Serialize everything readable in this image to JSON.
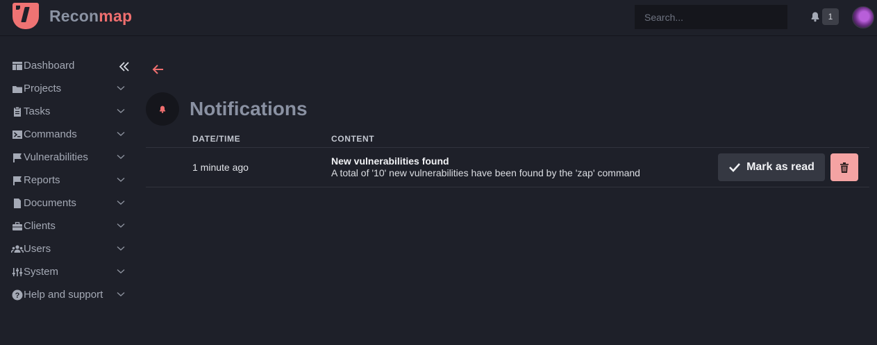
{
  "brand": {
    "part1": "Recon",
    "part2": "map",
    "accent": "#ef6f6f"
  },
  "header": {
    "search_placeholder": "Search...",
    "notification_count": "1"
  },
  "sidebar": {
    "items": [
      {
        "label": "Dashboard",
        "icon": "dashboard-icon"
      },
      {
        "label": "Projects",
        "icon": "folder-icon"
      },
      {
        "label": "Tasks",
        "icon": "clipboard-icon"
      },
      {
        "label": "Commands",
        "icon": "terminal-icon"
      },
      {
        "label": "Vulnerabilities",
        "icon": "flag-icon"
      },
      {
        "label": "Reports",
        "icon": "flag-icon"
      },
      {
        "label": "Documents",
        "icon": "document-icon"
      },
      {
        "label": "Clients",
        "icon": "briefcase-icon"
      },
      {
        "label": "Users",
        "icon": "users-icon"
      },
      {
        "label": "System",
        "icon": "sliders-icon"
      },
      {
        "label": "Help and support",
        "icon": "help-icon"
      }
    ]
  },
  "main": {
    "title": "Notifications",
    "columns": [
      "DATE/TIME",
      "CONTENT"
    ],
    "rows": [
      {
        "time": "1 minute ago",
        "title": "New vulnerabilities found",
        "body": "A total of '10' new vulnerabilities have been found by the 'zap' command",
        "mark_label": "Mark as read"
      }
    ]
  }
}
